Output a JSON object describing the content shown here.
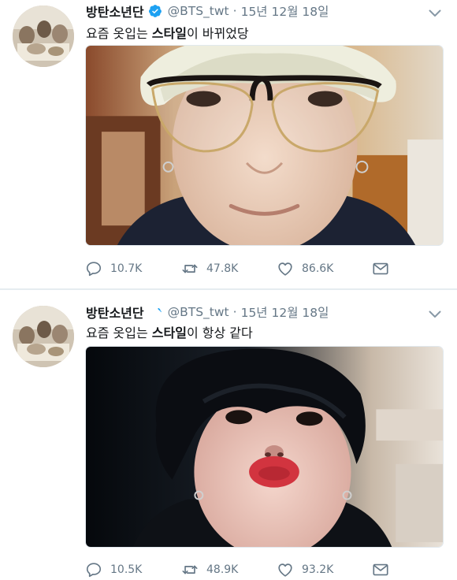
{
  "tweets": [
    {
      "author": {
        "name": "방탄소년단",
        "handle": "@BTS_twt",
        "verified": true
      },
      "separator": "·",
      "date": "15년 12월 18일",
      "text": {
        "before": "요즘 옷입는 ",
        "highlight": "스타일",
        "after": "이 바뀌었당"
      },
      "stats": {
        "replies": "10.7K",
        "retweets": "47.8K",
        "likes": "86.6K"
      }
    },
    {
      "author": {
        "name": "방탄소년단",
        "handle": "@BTS_twt",
        "verified": true
      },
      "separator": "·",
      "date": "15년 12월 18일",
      "text": {
        "before": "요즘 옷입는 ",
        "highlight": "스타일",
        "after": "이 항상 같다"
      },
      "stats": {
        "replies": "10.5K",
        "retweets": "48.9K",
        "likes": "93.2K"
      }
    }
  ],
  "icons": {
    "verified": "verified-badge-icon",
    "menu": "chevron-down-icon",
    "reply": "reply-icon",
    "retweet": "retweet-icon",
    "like": "heart-icon",
    "dm": "envelope-icon"
  },
  "colors": {
    "verified": "#1da1f2",
    "secondary_text": "#657786",
    "icon": "#657786"
  }
}
